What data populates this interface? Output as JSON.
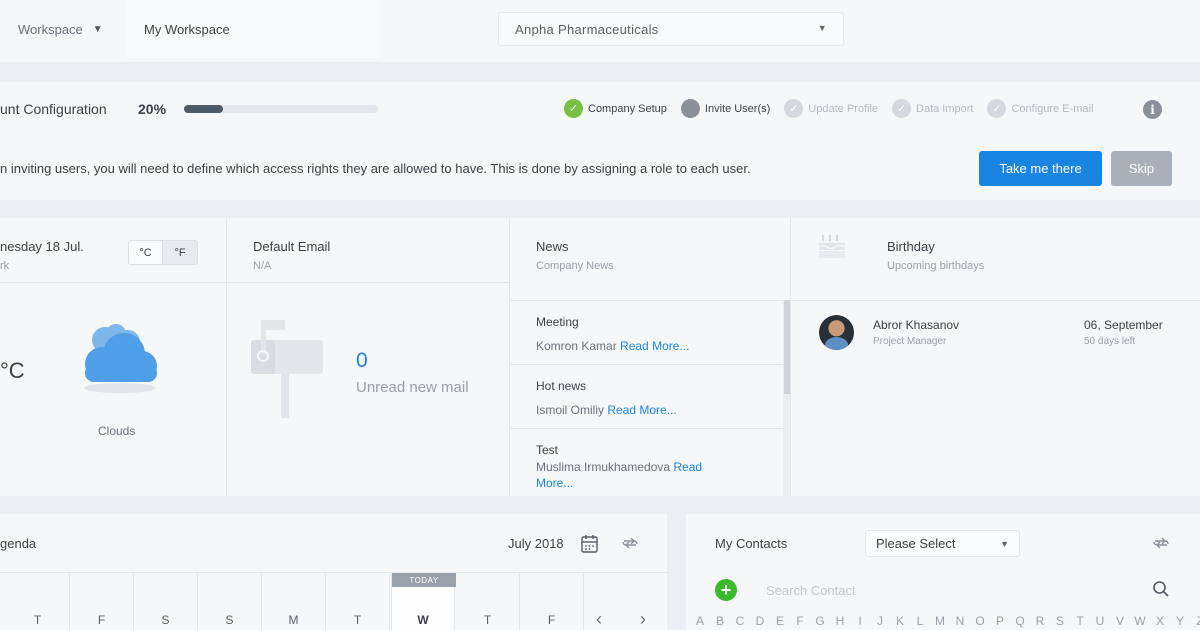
{
  "topbar": {
    "workspace_label": "Workspace",
    "workspace_name": "My Workspace",
    "company": "Anpha Pharmaceuticals"
  },
  "config": {
    "title": "unt Configuration",
    "progress_label": "20%",
    "progress": 0.2,
    "steps": [
      {
        "label": "Company Setup",
        "state": "done"
      },
      {
        "label": "Invite User(s)",
        "state": "current"
      },
      {
        "label": "Update Profile",
        "state": "todo"
      },
      {
        "label": "Data Import",
        "state": "todo"
      },
      {
        "label": "Configure E-mail",
        "state": "todo"
      }
    ],
    "info_icon": "i"
  },
  "notice": {
    "text": "n inviting users, you will need to define which access rights they are allowed to have. This is done by assigning a role to each user.",
    "primary_button": "Take me there",
    "skip_button": "Skip"
  },
  "weather": {
    "date": "nesday 18 Jul.",
    "location": "rk",
    "unit_c": "°C",
    "unit_f": "°F",
    "temperature": "°C",
    "condition": "Clouds"
  },
  "email": {
    "title": "Default Email",
    "subtitle": "N/A",
    "count": "0",
    "count_label": "Unread new mail"
  },
  "news": {
    "title": "News",
    "subtitle": "Company News",
    "items": [
      {
        "title": "Meeting",
        "author": "Komron Kamar",
        "read_more": "Read More..."
      },
      {
        "title": "Hot news",
        "author": "Ismoil Omiliy",
        "read_more": "Read More..."
      },
      {
        "title": "Test",
        "author": "Muslima Irmukhamedova",
        "read_more": "Read More..."
      }
    ]
  },
  "birthday": {
    "title": "Birthday",
    "subtitle": "Upcoming birthdays",
    "person": {
      "name": "Abror Khasanov",
      "role": "Project Manager",
      "date": "06, September",
      "days_left": "50 days left"
    }
  },
  "agenda": {
    "title": "genda",
    "month": "July 2018",
    "today_badge": "TODAY",
    "days": [
      "T",
      "F",
      "S",
      "S",
      "M",
      "T",
      "W",
      "T",
      "F"
    ],
    "today_index": 6,
    "prev": "‹",
    "next": "›"
  },
  "contacts": {
    "title": "My Contacts",
    "select_value": "Please Select",
    "add": "+",
    "search_placeholder": "Search Contact",
    "alphabet": [
      "A",
      "B",
      "C",
      "D",
      "E",
      "F",
      "G",
      "H",
      "I",
      "J",
      "K",
      "L",
      "M",
      "N",
      "O",
      "P",
      "Q",
      "R",
      "S",
      "T",
      "U",
      "V",
      "W",
      "X",
      "Y",
      "Z"
    ]
  },
  "colors": {
    "accent": "#1a85e0",
    "success": "#76c043",
    "add_button": "#3cba2e",
    "cloud": "#4f9ee8"
  }
}
